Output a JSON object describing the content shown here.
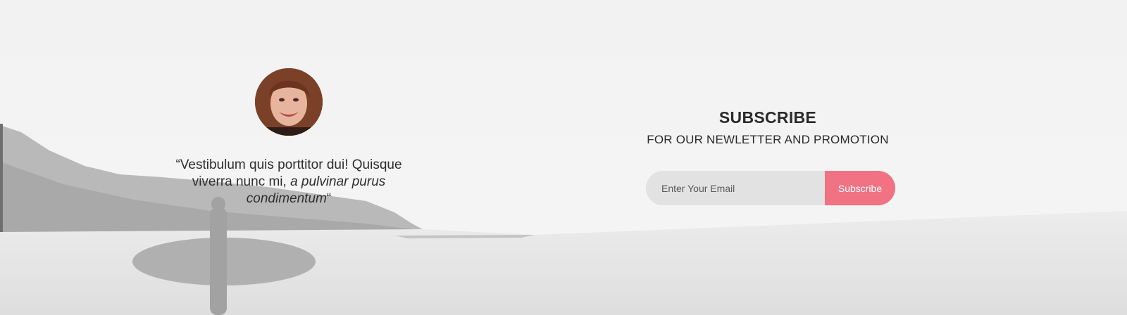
{
  "testimonial": {
    "avatar_icon": "person-avatar",
    "quote_prefix": "“Vestibulum quis porttitor dui! Quisque viverra nunc mi, ",
    "quote_italic": "a pulvinar purus condimentum",
    "quote_suffix": "“"
  },
  "subscribe": {
    "title": "SUBSCRIBE",
    "subtitle": "FOR OUR NEWLETTER AND PROMOTION",
    "email_placeholder": "Enter Your Email",
    "button_label": "Subscribe",
    "accent_color": "#f07283"
  }
}
